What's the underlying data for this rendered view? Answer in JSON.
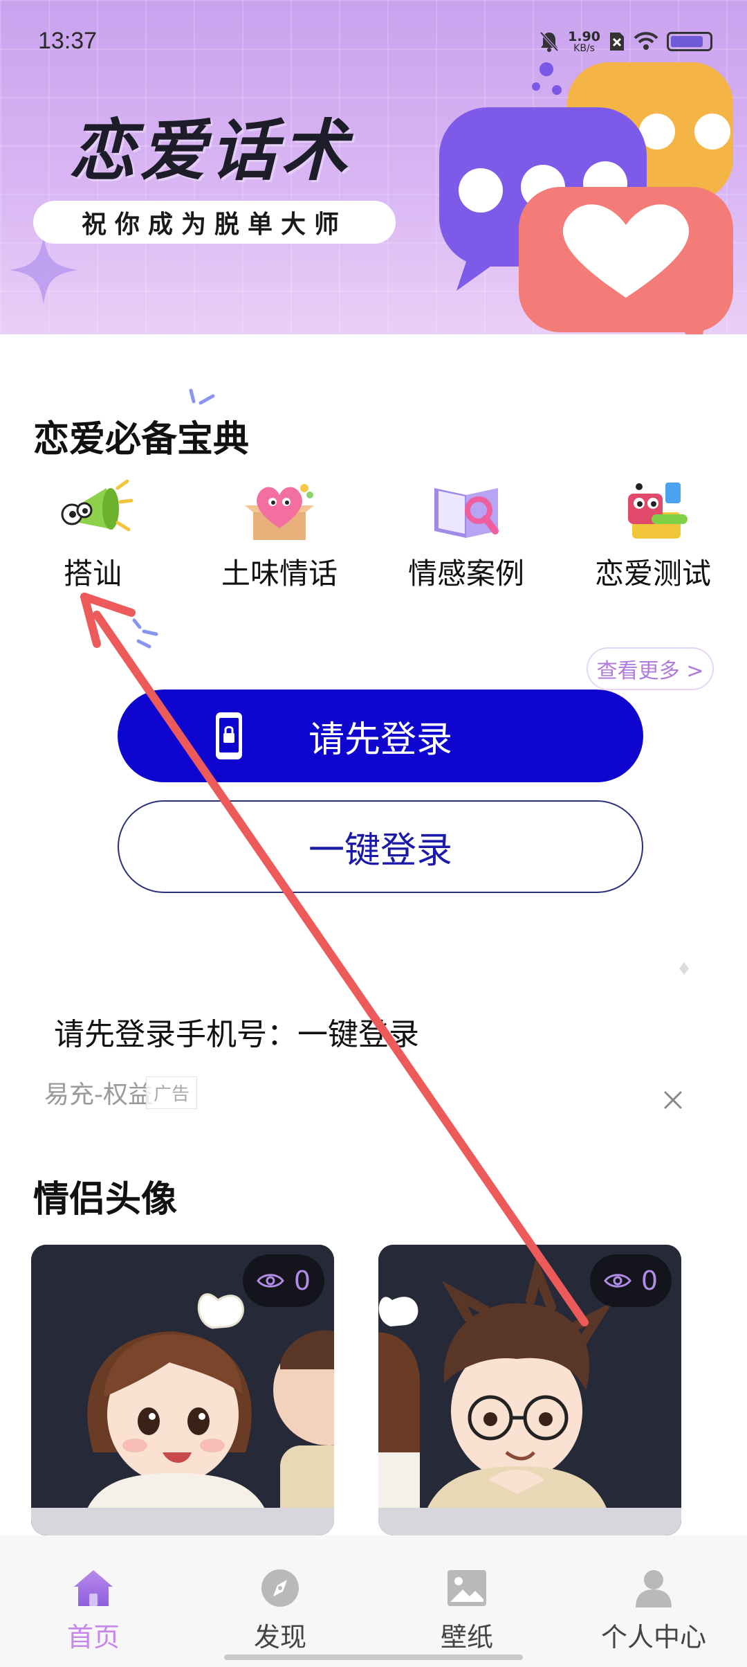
{
  "status_bar": {
    "time": "13:37",
    "net_speed_value": "1.90",
    "net_speed_unit": "KB/s",
    "battery_level": 0.85
  },
  "banner": {
    "title": "恋爱话术",
    "subtitle": "祝你成为脱单大师"
  },
  "handbook": {
    "title": "恋爱必备宝典",
    "categories": [
      {
        "label": "搭讪",
        "icon": "megaphone-icon"
      },
      {
        "label": "土味情话",
        "icon": "heart-gift-icon"
      },
      {
        "label": "情感案例",
        "icon": "book-magnifier-icon"
      },
      {
        "label": "恋爱测试",
        "icon": "test-robot-icon"
      }
    ],
    "more_label": "查看更多 >"
  },
  "login": {
    "primary_label": "请先登录",
    "secondary_label": "一键登录",
    "hint": "请先登录手机号：一键登录"
  },
  "ad": {
    "text": "易充-权益",
    "badge": "广告"
  },
  "couple_avatars": {
    "title": "情侣头像",
    "cards": [
      {
        "views": "0",
        "subject": "girl"
      },
      {
        "views": "0",
        "subject": "boy"
      }
    ]
  },
  "bottom_nav": {
    "items": [
      {
        "label": "首页",
        "icon": "home-icon",
        "active": true
      },
      {
        "label": "发现",
        "icon": "compass-icon",
        "active": false
      },
      {
        "label": "壁纸",
        "icon": "image-icon",
        "active": false
      },
      {
        "label": "个人中心",
        "icon": "person-icon",
        "active": false
      }
    ]
  },
  "colors": {
    "accent_blue": "#0e06cf",
    "accent_purple": "#c686ec",
    "annotation_arrow": "#ec5a5a"
  }
}
